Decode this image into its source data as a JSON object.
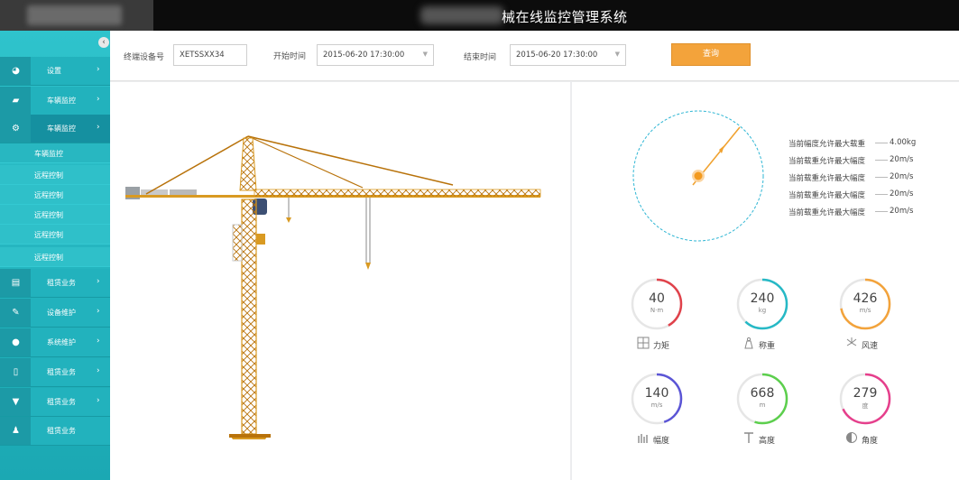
{
  "header": {
    "title": "械在线监控管理系统"
  },
  "sidebar": {
    "collapse_label": "‹",
    "items": [
      {
        "label": "设置",
        "icon": "dashboard-icon"
      },
      {
        "label": "车辆监控",
        "icon": "book-icon"
      },
      {
        "label": "车辆监控",
        "icon": "gears-icon",
        "expanded": true
      }
    ],
    "subitems": [
      "车辆监控",
      "远程控制",
      "远程控制",
      "远程控制",
      "远程控制",
      "远程控制"
    ],
    "items_after": [
      {
        "label": "租赁业务",
        "icon": "card-icon"
      },
      {
        "label": "设备维护",
        "icon": "pencil-icon"
      },
      {
        "label": "系统维护",
        "icon": "map-pin-icon"
      },
      {
        "label": "租赁业务",
        "icon": "document-icon"
      },
      {
        "label": "租赁业务",
        "icon": "cup-icon"
      },
      {
        "label": "租赁业务",
        "icon": "user-icon"
      }
    ]
  },
  "filter": {
    "device_label": "终端设备号",
    "device_value": "XETSSXX34",
    "start_label": "开始时间",
    "start_value": "2015-06-20   17:30:00",
    "end_label": "结束时间",
    "end_value": "2015-06-20   17:30:00",
    "query_label": "查询"
  },
  "loads": [
    {
      "label": "当前幅度允许最大载重",
      "value": "4.00kg"
    },
    {
      "label": "当前载重允许最大幅度",
      "value": "20m/s"
    },
    {
      "label": "当前载重允许最大幅度",
      "value": "20m/s"
    },
    {
      "label": "当前载重允许最大幅度",
      "value": "20m/s"
    },
    {
      "label": "当前载重允许最大幅度",
      "value": "20m/s"
    }
  ],
  "gauges": [
    {
      "value": "40",
      "unit": "N·m",
      "caption": "力矩",
      "color": "#e0424b",
      "icon": "grid-icon",
      "fraction": 0.42
    },
    {
      "value": "240",
      "unit": "kg",
      "caption": "称重",
      "color": "#26b9c6",
      "icon": "weight-icon",
      "fraction": 0.62
    },
    {
      "value": "426",
      "unit": "m/s",
      "caption": "风速",
      "color": "#f3a33b",
      "icon": "fan-icon",
      "fraction": 0.72
    },
    {
      "value": "140",
      "unit": "m/s",
      "caption": "幅度",
      "color": "#5b55d6",
      "icon": "bars-icon",
      "fraction": 0.45
    },
    {
      "value": "668",
      "unit": "m",
      "caption": "高度",
      "color": "#5ccf4d",
      "icon": "height-icon",
      "fraction": 0.55
    },
    {
      "value": "279",
      "unit": "度",
      "caption": "角度",
      "color": "#e63f8c",
      "icon": "angle-icon",
      "fraction": 0.68
    }
  ]
}
